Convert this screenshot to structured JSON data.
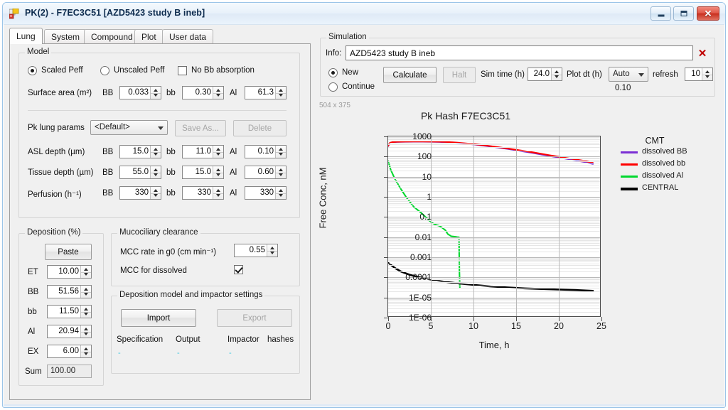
{
  "window": {
    "title": "PK(2) - F7EC3C51 [AZD5423 study B ineb]",
    "icon": "app-icon",
    "minimize_label": "",
    "maximize_label": "",
    "close_label": "✕"
  },
  "tabs": [
    {
      "label": "Lung",
      "active": true
    },
    {
      "label": "System",
      "active": false
    },
    {
      "label": "Compound",
      "active": false
    },
    {
      "label": "Plot",
      "active": false
    },
    {
      "label": "User data",
      "active": false
    }
  ],
  "model": {
    "group_label": "Model",
    "scaled_peff": "Scaled Peff",
    "unscaled_peff": "Unscaled Peff",
    "no_bb_absorption": "No Bb absorption",
    "surface_area_label": "Surface area (m²)",
    "bb_label": "BB",
    "bb_small_label": "bb",
    "al_label": "Al",
    "surface_area": {
      "BB": "0.033",
      "bb": "0.30",
      "Al": "61.3"
    },
    "pk_lung_params_label": "Pk lung params",
    "pk_lung_params_value": "<Default>",
    "save_as_label": "Save As...",
    "delete_label": "Delete",
    "asl_depth_label": "ASL depth (µm)",
    "asl_depth": {
      "BB": "15.0",
      "bb": "11.0",
      "Al": "0.10"
    },
    "tissue_depth_label": "Tissue depth (µm)",
    "tissue_depth": {
      "BB": "55.0",
      "bb": "15.0",
      "Al": "0.60"
    },
    "perfusion_label": "Perfusion (h⁻¹)",
    "perfusion": {
      "BB": "330",
      "bb": "330",
      "Al": "330"
    }
  },
  "deposition": {
    "group_label": "Deposition (%)",
    "paste_label": "Paste",
    "rows": [
      {
        "label": "ET",
        "value": "10.00"
      },
      {
        "label": "BB",
        "value": "51.56"
      },
      {
        "label": "bb",
        "value": "11.50"
      },
      {
        "label": "Al",
        "value": "20.94"
      },
      {
        "label": "EX",
        "value": "6.00"
      }
    ],
    "sum_label": "Sum",
    "sum_value": "100.00"
  },
  "mucociliary": {
    "group_label": "Mucociliary clearance",
    "mcc_rate_label": "MCC rate in g0 (cm min⁻¹)",
    "mcc_rate_value": "0.55",
    "mcc_dissolved_label": "MCC for dissolved",
    "mcc_dissolved_checked": true
  },
  "impactor": {
    "group_label": "Deposition model and impactor settings",
    "import_label": "Import",
    "export_label": "Export",
    "col_specification": "Specification",
    "col_output": "Output",
    "col_impactor": "Impactor",
    "col_hashes": "hashes",
    "link_specification": "-",
    "link_output": "-",
    "link_impactor": "-"
  },
  "simulation": {
    "group_label": "Simulation",
    "info_label": "Info:",
    "info_value": "AZD5423 study B ineb",
    "clear_label": "✕",
    "new_label": "New",
    "continue_label": "Continue",
    "calculate_label": "Calculate",
    "halt_label": "Halt",
    "sim_time_label": "Sim time (h)",
    "sim_time_value": "24.0",
    "plot_dt_label": "Plot dt (h)",
    "plot_dt_value": "Auto",
    "plot_dt_actual": "0.10",
    "refresh_label": "refresh",
    "refresh_value": "10"
  },
  "chart_panel": {
    "size_label": "504 x 375"
  },
  "chart_data": {
    "type": "line",
    "title": "Pk Hash F7EC3C51",
    "xlabel": "Time, h",
    "ylabel": "Free Conc, nM",
    "xlim": [
      0,
      25
    ],
    "xticks": [
      0,
      5,
      10,
      15,
      20,
      25
    ],
    "yscale": "log",
    "ylim": [
      1e-06,
      1000
    ],
    "yticks": [
      1000,
      100,
      10,
      1,
      0.1,
      0.01,
      0.001,
      0.0001,
      1e-05,
      1e-06
    ],
    "ytick_labels": [
      "1000",
      "100",
      "10",
      "1",
      "0.1",
      "0.01",
      "0.001",
      "0.0001",
      "1E-05",
      "1E-06"
    ],
    "grid": true,
    "legend_position": "right",
    "legend_title": "CMT",
    "series": [
      {
        "name": "dissolved BB",
        "color": "#7B2FD4",
        "x": [
          0,
          0.2,
          0.5,
          1,
          2,
          3,
          4,
          5,
          6,
          7,
          8,
          9,
          10,
          11,
          12,
          13,
          14,
          15,
          16,
          17,
          18,
          19,
          20,
          21,
          22,
          23,
          24
        ],
        "y": [
          330,
          470,
          510,
          530,
          540,
          545,
          545,
          540,
          530,
          510,
          480,
          440,
          400,
          355,
          315,
          275,
          240,
          205,
          175,
          150,
          125,
          105,
          90,
          76,
          64,
          54,
          43
        ]
      },
      {
        "name": "dissolved bb",
        "color": "#FF0000",
        "x": [
          0,
          0.2,
          0.5,
          1,
          2,
          3,
          4,
          5,
          6,
          7,
          8,
          9,
          10,
          11,
          12,
          13,
          14,
          15,
          16,
          17,
          18,
          19,
          20,
          21,
          22,
          23,
          24
        ],
        "y": [
          340,
          480,
          520,
          540,
          552,
          556,
          556,
          552,
          543,
          525,
          495,
          455,
          415,
          370,
          330,
          290,
          253,
          218,
          188,
          161,
          136,
          115,
          98,
          84,
          72,
          61,
          49
        ]
      },
      {
        "name": "dissolved Al",
        "color": "#00D82E",
        "x": [
          0,
          0.3,
          0.8,
          1.5,
          2.2,
          3.0,
          3.8,
          4.5,
          5.0,
          5.5,
          6.0,
          6.3,
          6.7,
          7.0,
          7.4,
          7.8,
          8.1,
          8.3,
          8.35,
          8.4
        ],
        "y": [
          60,
          22,
          7.5,
          2.4,
          0.85,
          0.32,
          0.17,
          0.09,
          0.055,
          0.042,
          0.036,
          0.03,
          0.022,
          0.014,
          0.011,
          0.0105,
          0.01,
          0.0098,
          0.0002,
          3e-05
        ]
      },
      {
        "name": "CENTRAL",
        "color": "#000000",
        "x": [
          0,
          0.3,
          0.8,
          1.5,
          2.5,
          3.5,
          4.5,
          5.5,
          7,
          8.5,
          10,
          12,
          14,
          16,
          18,
          20,
          22,
          24
        ],
        "y": [
          0.00052,
          0.00042,
          0.00029,
          0.000195,
          0.000135,
          0.000105,
          8.5e-05,
          7.2e-05,
          5.75e-05,
          4.85e-05,
          4.25e-05,
          3.55e-05,
          3.15e-05,
          2.85e-05,
          2.65e-05,
          2.48e-05,
          2.35e-05,
          2.15e-05
        ]
      }
    ]
  }
}
